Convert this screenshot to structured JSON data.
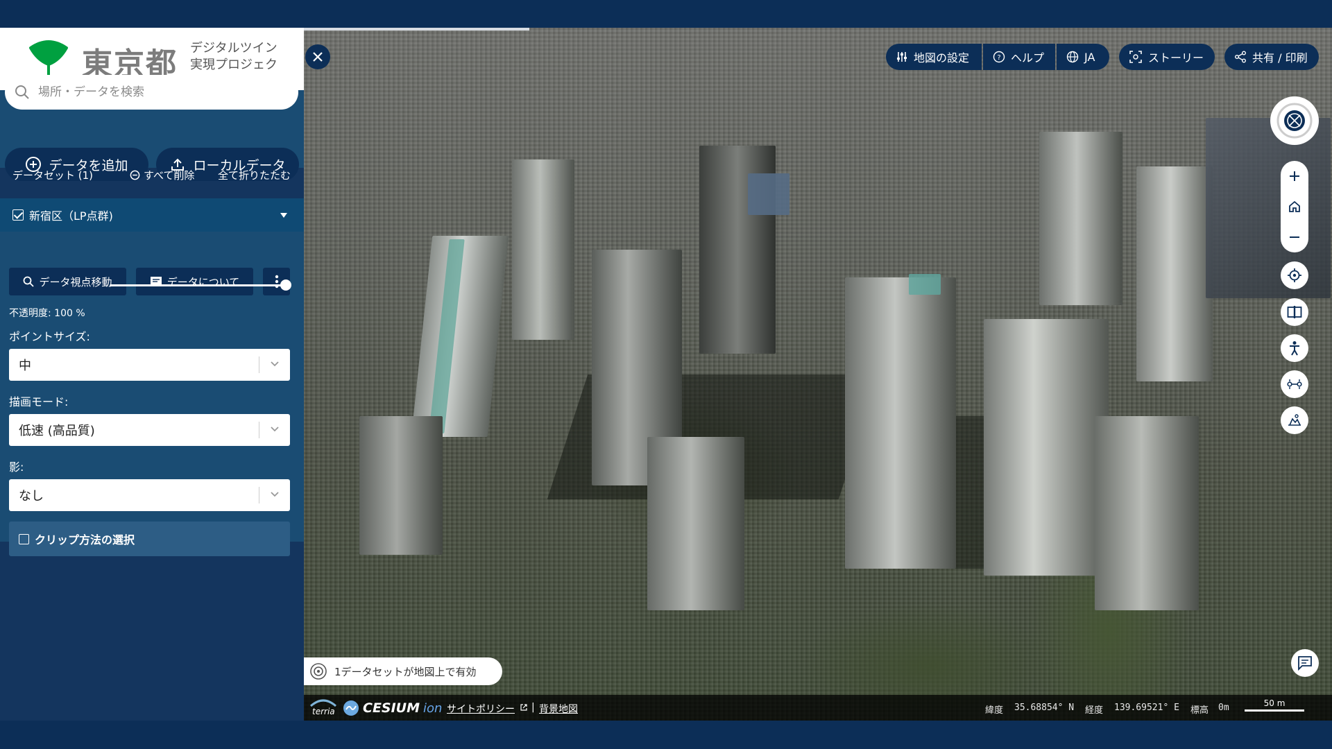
{
  "brand": {
    "title": "東京都",
    "subtitle": "デジタルツイン実現プロジェクト",
    "leaf_color": "#00a040"
  },
  "search": {
    "placeholder": "場所・データを検索"
  },
  "actions": {
    "add_data": "データを追加",
    "local_data": "ローカルデータ"
  },
  "dataset_bar": {
    "label": "データセット (1)",
    "remove_all": "すべて削除",
    "collapse_all": "全て折りたたむ"
  },
  "dataset": {
    "name": "新宿区（LP点群)",
    "checked": true,
    "zoom_button": "データ視点移動",
    "about_button": "データについて",
    "opacity_label": "不透明度: 100 %",
    "opacity_fraction": 1.0,
    "point_size_label": "ポイントサイズ:",
    "point_size_value": "中",
    "render_mode_label": "描画モード:",
    "render_mode_value": "低速 (高品質)",
    "shadow_label": "影:",
    "shadow_value": "なし",
    "clip_label": "クリップ方法の選択",
    "clip_checked": false
  },
  "top_toolbar": {
    "map_settings": "地図の設定",
    "help": "ヘルプ",
    "language": "JA",
    "story": "ストーリー",
    "share": "共有 / 印刷"
  },
  "status": {
    "text": "1データセットが地図上で有効"
  },
  "bottom_bar": {
    "terria": "terria",
    "cesium": "CESIUM",
    "ion": "ion",
    "site_policy": "サイトポリシー",
    "separator": "|",
    "basemap": "背景地図",
    "lat_label": "緯度",
    "lat_value": "35.68854° N",
    "lon_label": "経度",
    "lon_value": "139.69521° E",
    "elev_label": "標高",
    "elev_value": "0m",
    "scale_label": "50 m"
  },
  "colors": {
    "accent": "#0c2e57",
    "panel": "#1a4c73",
    "header_band": "#0f4a74"
  }
}
